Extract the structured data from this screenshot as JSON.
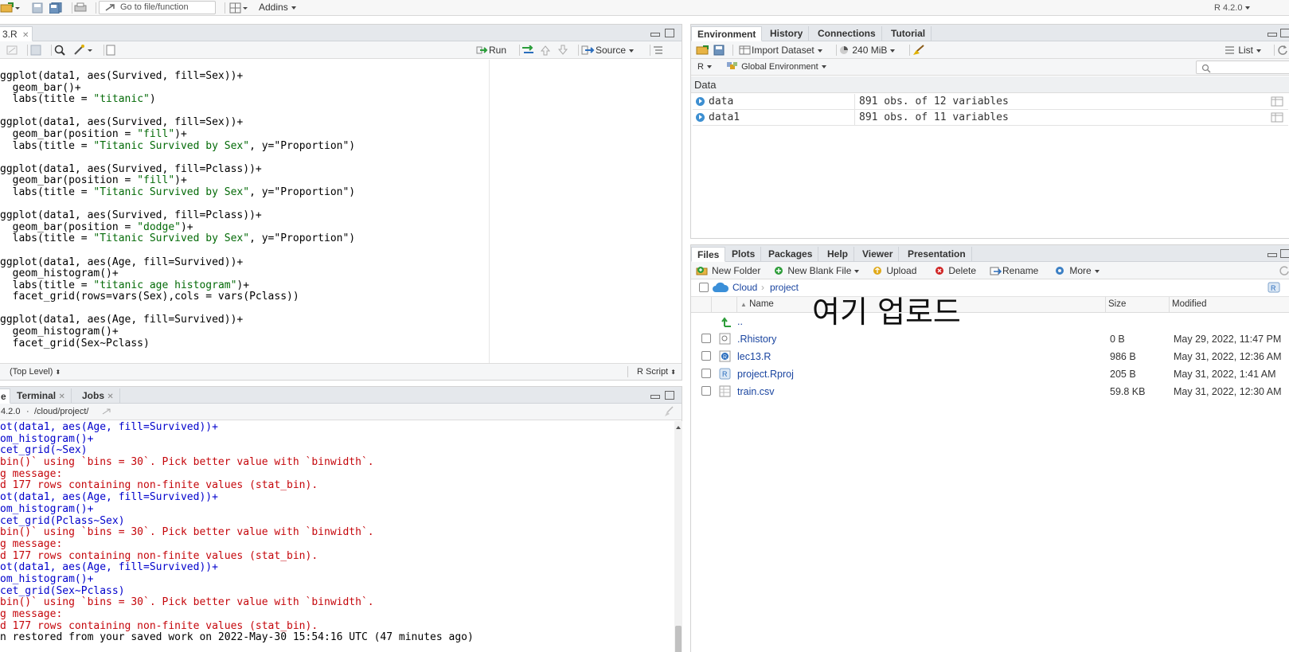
{
  "topbar": {
    "goto_placeholder": "Go to file/function",
    "addins_label": "Addins",
    "r_version": "R 4.2.0"
  },
  "editor": {
    "tab_label": "3.R",
    "run_label": "Run",
    "source_label": "Source",
    "code_lines": [
      {
        "pre": "ggplot(data1, aes(Survived, fill=Sex))+",
        "str": "",
        "post": ""
      },
      {
        "pre": "  geom_bar()+",
        "str": "",
        "post": ""
      },
      {
        "pre": "  labs(title = ",
        "str": "\"titanic\"",
        "post": ")"
      },
      {
        "pre": "",
        "str": "",
        "post": ""
      },
      {
        "pre": "ggplot(data1, aes(Survived, fill=Sex))+",
        "str": "",
        "post": ""
      },
      {
        "pre": "  geom_bar(position = ",
        "str": "\"fill\"",
        "post": ")+"
      },
      {
        "pre": "  labs(title = ",
        "str": "\"Titanic Survived by Sex\"",
        "post": ", y=\"Proportion\")"
      },
      {
        "pre": "",
        "str": "",
        "post": ""
      },
      {
        "pre": "ggplot(data1, aes(Survived, fill=Pclass))+",
        "str": "",
        "post": ""
      },
      {
        "pre": "  geom_bar(position = ",
        "str": "\"fill\"",
        "post": ")+"
      },
      {
        "pre": "  labs(title = ",
        "str": "\"Titanic Survived by Sex\"",
        "post": ", y=\"Proportion\")"
      },
      {
        "pre": "",
        "str": "",
        "post": ""
      },
      {
        "pre": "ggplot(data1, aes(Survived, fill=Pclass))+",
        "str": "",
        "post": ""
      },
      {
        "pre": "  geom_bar(position = ",
        "str": "\"dodge\"",
        "post": ")+"
      },
      {
        "pre": "  labs(title = ",
        "str": "\"Titanic Survived by Sex\"",
        "post": ", y=\"Proportion\")"
      },
      {
        "pre": "",
        "str": "",
        "post": ""
      },
      {
        "pre": "ggplot(data1, aes(Age, fill=Survived))+",
        "str": "",
        "post": ""
      },
      {
        "pre": "  geom_histogram()+",
        "str": "",
        "post": ""
      },
      {
        "pre": "  labs(title = ",
        "str": "\"titanic age histogram\"",
        "post": ")+"
      },
      {
        "pre": "  facet_grid(rows=vars(Sex),cols = vars(Pclass))",
        "str": "",
        "post": ""
      },
      {
        "pre": "",
        "str": "",
        "post": ""
      },
      {
        "pre": "ggplot(data1, aes(Age, fill=Survived))+",
        "str": "",
        "post": ""
      },
      {
        "pre": "  geom_histogram()+",
        "str": "",
        "post": ""
      },
      {
        "pre": "  facet_grid(Sex~Pclass)",
        "str": "",
        "post": ""
      }
    ],
    "status_left": "(Top Level)",
    "status_right": "R Script"
  },
  "console": {
    "tab_partial": "e",
    "terminal_label": "Terminal",
    "jobs_label": "Jobs",
    "path_prefix": "4.2.0",
    "path": "/cloud/project/",
    "lines": [
      {
        "cls": "blue",
        "text": "ot(data1, aes(Age, fill=Survived))+"
      },
      {
        "cls": "blue",
        "text": "om_histogram()+"
      },
      {
        "cls": "blue",
        "text": "cet_grid(~Sex)"
      },
      {
        "cls": "red",
        "text": "bin()` using `bins = 30`. Pick better value with `binwidth`."
      },
      {
        "cls": "red",
        "text": "g message:"
      },
      {
        "cls": "red",
        "text": "d 177 rows containing non-finite values (stat_bin)."
      },
      {
        "cls": "blue",
        "text": "ot(data1, aes(Age, fill=Survived))+"
      },
      {
        "cls": "blue",
        "text": "om_histogram()+"
      },
      {
        "cls": "blue",
        "text": "cet_grid(Pclass~Sex)"
      },
      {
        "cls": "red",
        "text": "bin()` using `bins = 30`. Pick better value with `binwidth`."
      },
      {
        "cls": "red",
        "text": "g message:"
      },
      {
        "cls": "red",
        "text": "d 177 rows containing non-finite values (stat_bin)."
      },
      {
        "cls": "blue",
        "text": "ot(data1, aes(Age, fill=Survived))+"
      },
      {
        "cls": "blue",
        "text": "om_histogram()+"
      },
      {
        "cls": "blue",
        "text": "cet_grid(Sex~Pclass)"
      },
      {
        "cls": "red",
        "text": "bin()` using `bins = 30`. Pick better value with `binwidth`."
      },
      {
        "cls": "red",
        "text": "g message:"
      },
      {
        "cls": "red",
        "text": "d 177 rows containing non-finite values (stat_bin)."
      },
      {
        "cls": "black",
        "text": "n restored from your saved work on 2022-May-30 15:54:16 UTC (47 minutes ago)"
      }
    ]
  },
  "env": {
    "tabs": [
      "Environment",
      "History",
      "Connections",
      "Tutorial"
    ],
    "import_label": "Import Dataset",
    "memory_label": "240 MiB",
    "list_label": "List",
    "lang_label": "R",
    "scope_label": "Global Environment",
    "section_label": "Data",
    "rows": [
      {
        "name": "data",
        "value": "891 obs. of 12 variables"
      },
      {
        "name": "data1",
        "value": "891 obs. of 11 variables"
      }
    ]
  },
  "files": {
    "tabs": [
      "Files",
      "Plots",
      "Packages",
      "Help",
      "Viewer",
      "Presentation"
    ],
    "new_folder": "New Folder",
    "new_blank_file": "New Blank File",
    "upload": "Upload",
    "delete": "Delete",
    "rename": "Rename",
    "more": "More",
    "breadcrumb": [
      "Cloud",
      "project"
    ],
    "col_name": "Name",
    "col_size": "Size",
    "col_modified": "Modified",
    "parent_dir": "..",
    "overlay_text": "여기 업로드",
    "rows": [
      {
        "name": ".Rhistory",
        "size": "0 B",
        "modified": "May 29, 2022, 11:47 PM"
      },
      {
        "name": "lec13.R",
        "size": "986 B",
        "modified": "May 31, 2022, 12:36 AM"
      },
      {
        "name": "project.Rproj",
        "size": "205 B",
        "modified": "May 31, 2022, 1:41 AM"
      },
      {
        "name": "train.csv",
        "size": "59.8 KB",
        "modified": "May 31, 2022, 12:30 AM"
      }
    ]
  }
}
